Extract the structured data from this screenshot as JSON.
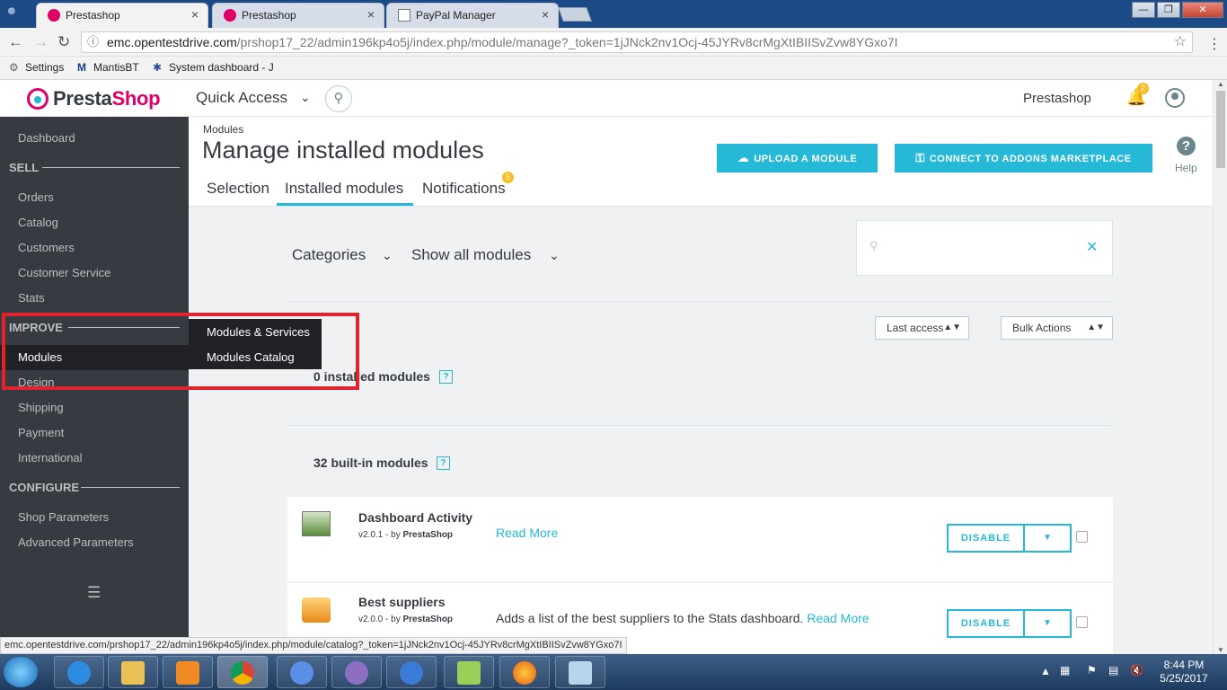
{
  "browser": {
    "tabs": [
      {
        "label": "Prestashop",
        "active": true
      },
      {
        "label": "Prestashop",
        "active": false
      },
      {
        "label": "PayPal Manager",
        "active": false
      }
    ],
    "close_glyph": "×",
    "url_host": "emc.opentestdrive.com",
    "url_path": "/prshop17_22/admin196kp4o5j/index.php/module/manage?_token=1jJNck2nv1Ocj-45JYRv8crMgXtIBIISvZvw8YGxo7I",
    "bookmarks": [
      "Settings",
      "MantisBT",
      "System dashboard - J"
    ],
    "status_url": "emc.opentestdrive.com/prshop17_22/admin196kp4o5j/index.php/module/catalog?_token=1jJNck2nv1Ocj-45JYRv8crMgXtIBIISvZvw8YGxo7I"
  },
  "topnav": {
    "logo_a": "Presta",
    "logo_b": "Shop",
    "quick_access": "Quick Access",
    "shop_name": "Prestashop",
    "notification_count": "2"
  },
  "sidebar": {
    "dashboard": "Dashboard",
    "sections": {
      "sell": "SELL",
      "improve": "IMPROVE",
      "configure": "CONFIGURE"
    },
    "sell_items": [
      "Orders",
      "Catalog",
      "Customers",
      "Customer Service",
      "Stats"
    ],
    "improve_items": [
      "Modules",
      "Design",
      "Shipping",
      "Payment",
      "International"
    ],
    "configure_items": [
      "Shop Parameters",
      "Advanced Parameters"
    ],
    "flyout": [
      "Modules & Services",
      "Modules Catalog"
    ]
  },
  "header": {
    "breadcrumb": "Modules",
    "title": "Manage installed modules",
    "upload_button": "UPLOAD A MODULE",
    "connect_button": "CONNECT TO ADDONS MARKETPLACE",
    "help_label": "Help",
    "tabs": [
      "Selection",
      "Installed modules",
      "Notifications"
    ],
    "notifications_badge": "5"
  },
  "filters": {
    "categories": "Categories",
    "show_all": "Show all modules",
    "sort_select": "Last access",
    "bulk_select": "Bulk Actions",
    "search_placeholder": ""
  },
  "sections": {
    "installed_title": "0 installed modules",
    "builtin_title": "32 built-in modules"
  },
  "modules": [
    {
      "name": "Dashboard Activity",
      "version": "v2.0.1 - by ",
      "author": "PrestaShop",
      "description": "",
      "read_more": "Read More",
      "action": "DISABLE"
    },
    {
      "name": "Best suppliers",
      "version": "v2.0.0 - by ",
      "author": "PrestaShop",
      "description": "Adds a list of the best suppliers to the Stats dashboard. ",
      "read_more": "Read More",
      "action": "DISABLE"
    }
  ],
  "taskbar": {
    "time": "8:44 PM",
    "date": "5/25/2017"
  },
  "colors": {
    "accent": "#25b9d7",
    "sidebar": "#363a41",
    "brand_pink": "#df0067",
    "badge": "#fbbb22",
    "highlight": "#e0232d"
  }
}
